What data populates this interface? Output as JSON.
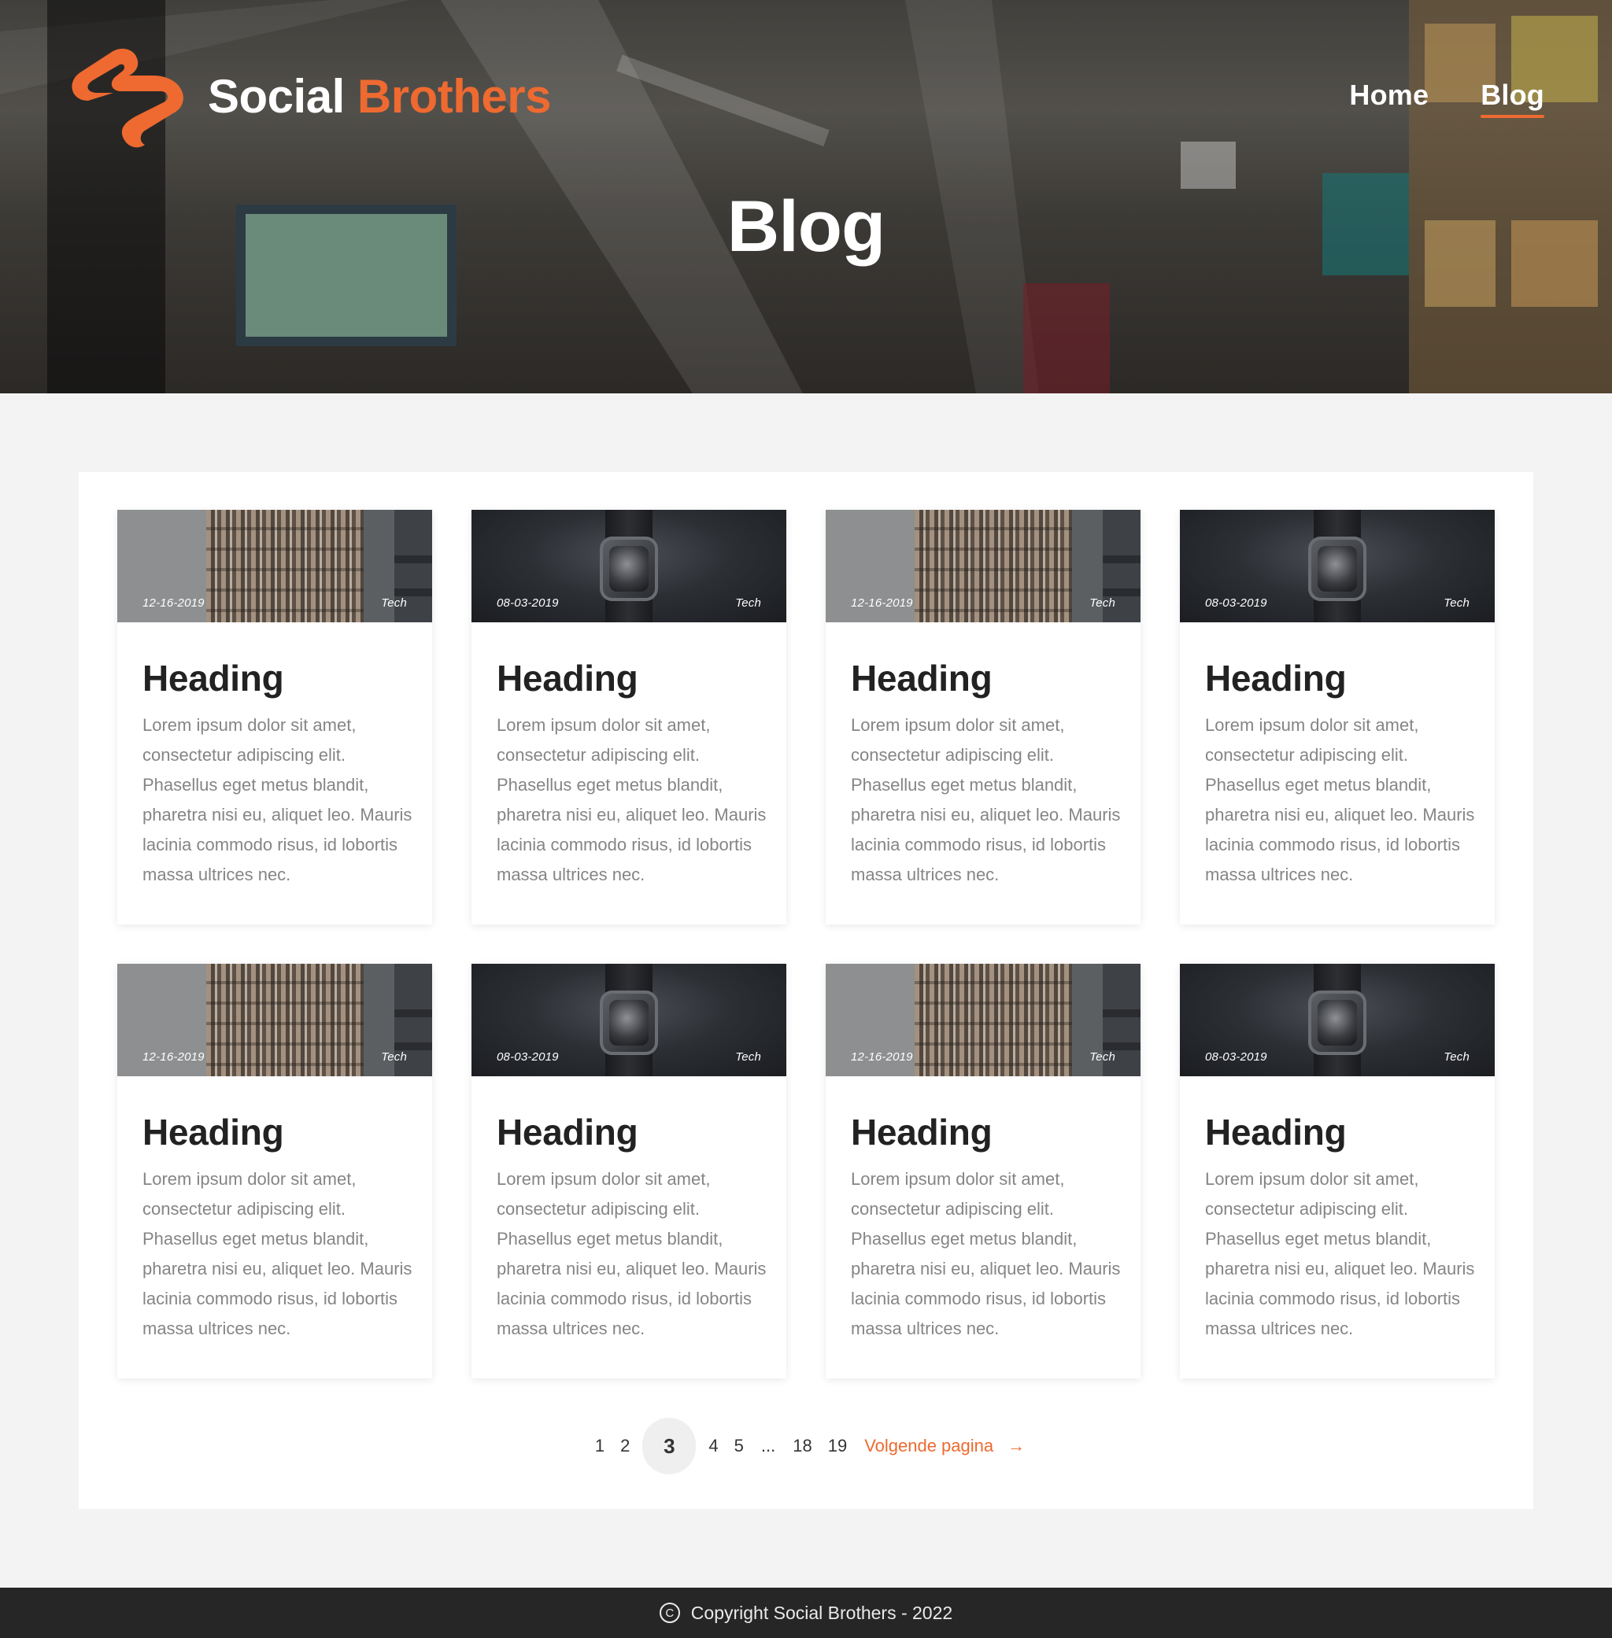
{
  "header": {
    "brand_part1": "Social",
    "brand_part2": "Brothers",
    "brand_color": "#ee6a30",
    "logo_icon": "social-brothers-logo",
    "nav": [
      {
        "label": "Home",
        "active": false
      },
      {
        "label": "Blog",
        "active": true
      }
    ],
    "hero_title": "Blog"
  },
  "posts": [
    {
      "date": "12-16-2019",
      "category": "Tech",
      "image": "building",
      "heading": "Heading",
      "body": "Lorem ipsum dolor sit amet, consectetur adipiscing elit. Phasellus eget metus blandit, pharetra nisi eu, aliquet leo. Mauris lacinia commodo risus, id lobortis massa ultrices nec."
    },
    {
      "date": "08-03-2019",
      "category": "Tech",
      "image": "watch",
      "heading": "Heading",
      "body": "Lorem ipsum dolor sit amet, consectetur adipiscing elit. Phasellus eget metus blandit, pharetra nisi eu, aliquet leo. Mauris lacinia commodo risus, id lobortis massa ultrices nec."
    },
    {
      "date": "12-16-2019",
      "category": "Tech",
      "image": "building",
      "heading": "Heading",
      "body": "Lorem ipsum dolor sit amet, consectetur adipiscing elit. Phasellus eget metus blandit, pharetra nisi eu, aliquet leo. Mauris lacinia commodo risus, id lobortis massa ultrices nec."
    },
    {
      "date": "08-03-2019",
      "category": "Tech",
      "image": "watch",
      "heading": "Heading",
      "body": "Lorem ipsum dolor sit amet, consectetur adipiscing elit. Phasellus eget metus blandit, pharetra nisi eu, aliquet leo. Mauris lacinia commodo risus, id lobortis massa ultrices nec."
    },
    {
      "date": "12-16-2019",
      "category": "Tech",
      "image": "building",
      "heading": "Heading",
      "body": "Lorem ipsum dolor sit amet, consectetur adipiscing elit. Phasellus eget metus blandit, pharetra nisi eu, aliquet leo. Mauris lacinia commodo risus, id lobortis massa ultrices nec."
    },
    {
      "date": "08-03-2019",
      "category": "Tech",
      "image": "watch",
      "heading": "Heading",
      "body": "Lorem ipsum dolor sit amet, consectetur adipiscing elit. Phasellus eget metus blandit, pharetra nisi eu, aliquet leo. Mauris lacinia commodo risus, id lobortis massa ultrices nec."
    },
    {
      "date": "12-16-2019",
      "category": "Tech",
      "image": "building",
      "heading": "Heading",
      "body": "Lorem ipsum dolor sit amet, consectetur adipiscing elit. Phasellus eget metus blandit, pharetra nisi eu, aliquet leo. Mauris lacinia commodo risus, id lobortis massa ultrices nec."
    },
    {
      "date": "08-03-2019",
      "category": "Tech",
      "image": "watch",
      "heading": "Heading",
      "body": "Lorem ipsum dolor sit amet, consectetur adipiscing elit. Phasellus eget metus blandit, pharetra nisi eu, aliquet leo. Mauris lacinia commodo risus, id lobortis massa ultrices nec."
    }
  ],
  "pagination": {
    "pages": [
      "1",
      "2",
      "3",
      "4",
      "5",
      "...",
      "18",
      "19"
    ],
    "current": "3",
    "next_label": "Volgende pagina",
    "next_icon": "arrow-right-icon"
  },
  "footer": {
    "copyright_icon": "copyright-icon",
    "text": "Copyright Social Brothers - 2022"
  }
}
